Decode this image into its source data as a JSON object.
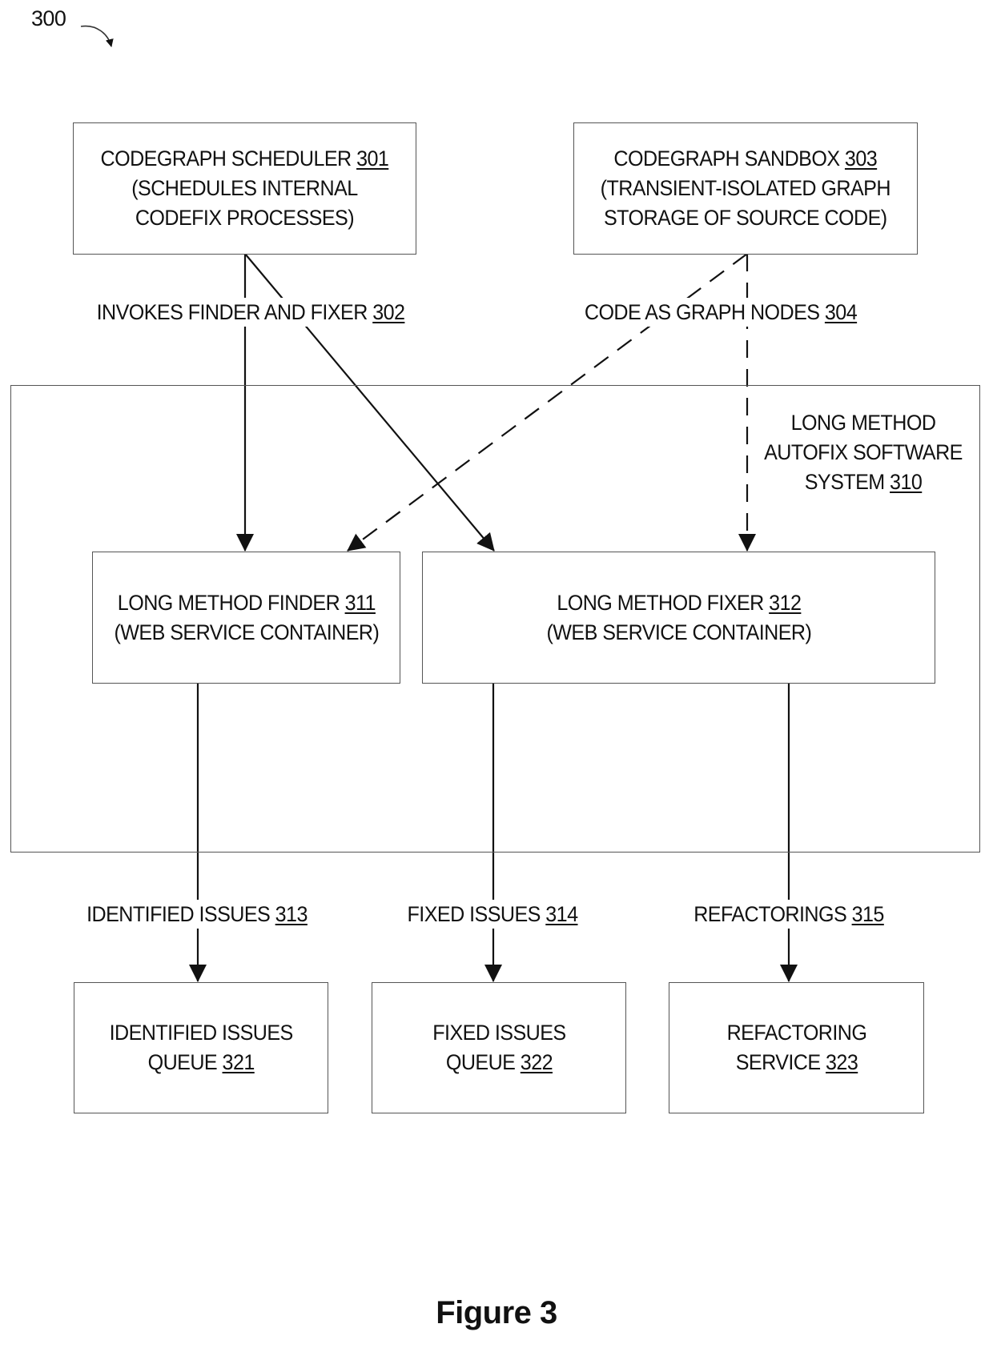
{
  "figure": {
    "reference": "300",
    "caption": "Figure 3"
  },
  "nodes": {
    "scheduler": {
      "lines": [
        "CODEGRAPH SCHEDULER",
        "(SCHEDULES INTERNAL",
        "CODEFIX PROCESSES)"
      ],
      "ref": "301"
    },
    "sandbox": {
      "lines": [
        "CODEGRAPH SANDBOX",
        "(TRANSIENT-ISOLATED GRAPH",
        "STORAGE OF SOURCE CODE)"
      ],
      "ref": "303"
    },
    "system": {
      "lines": [
        "LONG METHOD",
        "AUTOFIX SOFTWARE",
        "SYSTEM"
      ],
      "ref": "310"
    },
    "finder": {
      "lines": [
        "LONG METHOD FINDER",
        "(WEB SERVICE CONTAINER)"
      ],
      "ref": "311"
    },
    "fixer": {
      "lines": [
        "LONG METHOD FIXER",
        "(WEB SERVICE CONTAINER)"
      ],
      "ref": "312"
    },
    "identified_queue": {
      "lines": [
        "IDENTIFIED ISSUES",
        "QUEUE"
      ],
      "ref": "321"
    },
    "fixed_queue": {
      "lines": [
        "FIXED ISSUES",
        "QUEUE"
      ],
      "ref": "322"
    },
    "refactoring_service": {
      "lines": [
        "REFACTORING",
        "SERVICE"
      ],
      "ref": "323"
    }
  },
  "edges": {
    "invokes": {
      "label": "INVOKES FINDER AND FIXER",
      "ref": "302",
      "style": "solid",
      "from": "scheduler",
      "to": [
        "finder",
        "fixer"
      ]
    },
    "code_as_graph": {
      "label": "CODE AS GRAPH NODES",
      "ref": "304",
      "style": "dashed",
      "from": "sandbox",
      "to": [
        "finder",
        "fixer"
      ]
    },
    "identified": {
      "label": "IDENTIFIED ISSUES",
      "ref": "313",
      "style": "solid",
      "from": "finder",
      "to": "identified_queue"
    },
    "fixed": {
      "label": "FIXED ISSUES",
      "ref": "314",
      "style": "solid",
      "from": "fixer",
      "to": "fixed_queue"
    },
    "refactorings": {
      "label": "REFACTORINGS",
      "ref": "315",
      "style": "solid",
      "from": "fixer",
      "to": "refactoring_service"
    }
  }
}
